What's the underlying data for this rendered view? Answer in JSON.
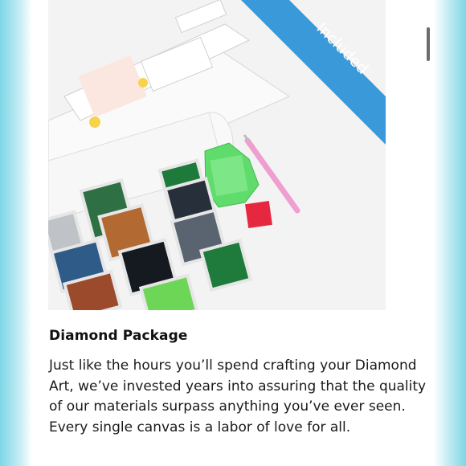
{
  "product_image": {
    "alt": "Diamond art kit contents",
    "ribbon_text": "Included",
    "ribbon_color": "#3a9ad9"
  },
  "section": {
    "title": "Diamond Package",
    "description": "Just like the hours you’ll spend crafting your Diamond Art, we’ve invested years into assuring that the quality of our materials surpass anything you’ve ever seen. Every single canvas is a labor of love for all."
  },
  "colors": {
    "side_accent": "#7fd6e6",
    "text": "#111111"
  }
}
